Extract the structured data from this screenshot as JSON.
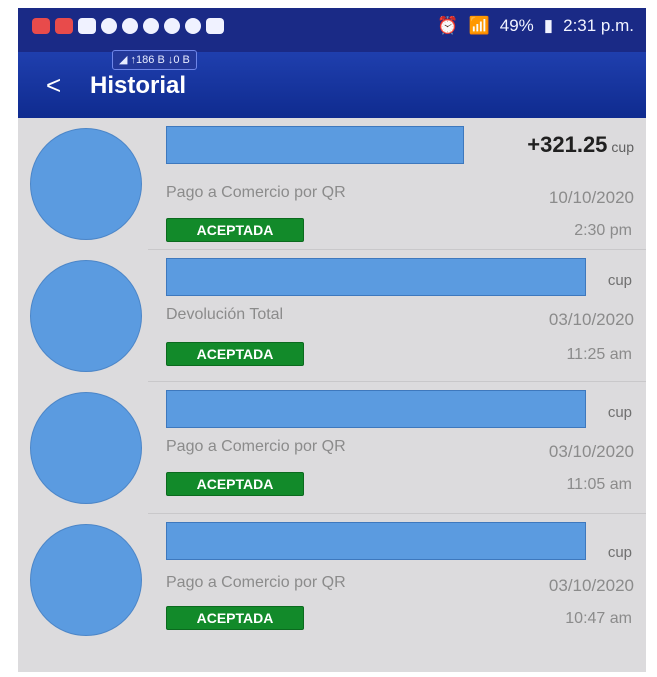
{
  "statusbar": {
    "battery": "49%",
    "time": "2:31 p.m.",
    "net_up": "↑186 B",
    "net_down": "↓0 B"
  },
  "header": {
    "back_icon": "back-arrow-icon",
    "title": "Historial"
  },
  "transactions": [
    {
      "amount": "+321.25",
      "currency": "cup",
      "description": "Pago a Comercio por QR",
      "date": "10/10/2020",
      "status": "ACEPTADA",
      "time": "2:30 pm"
    },
    {
      "amount": "",
      "currency": "cup",
      "description": "Devolución Total",
      "date": "03/10/2020",
      "status": "ACEPTADA",
      "time": "11:25 am"
    },
    {
      "amount": "",
      "currency": "cup",
      "description": "Pago a Comercio por QR",
      "date": "03/10/2020",
      "status": "ACEPTADA",
      "time": "11:05 am"
    },
    {
      "amount": "",
      "currency": "cup",
      "description": "Pago a Comercio por QR",
      "date": "03/10/2020",
      "status": "ACEPTADA",
      "time": "10:47 am"
    }
  ],
  "colors": {
    "appbar": "#1f3fae",
    "avatar": "#5b9be0",
    "status_accepted": "#128a2a",
    "background": "#dcdbdd"
  }
}
